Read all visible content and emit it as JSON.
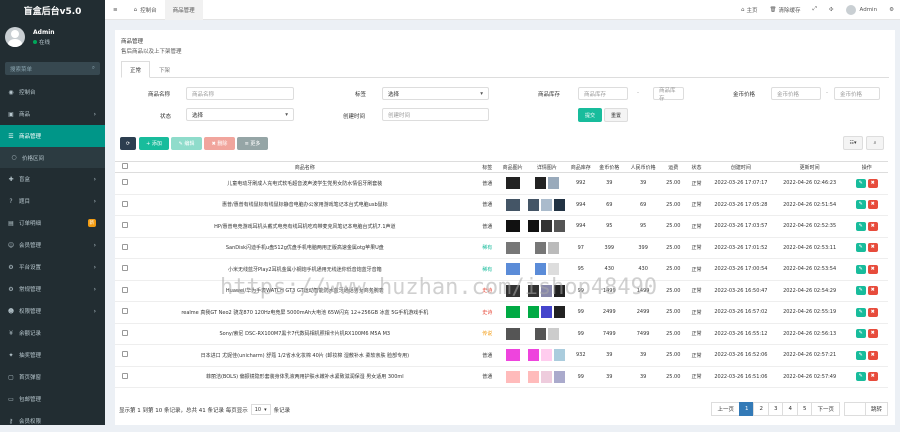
{
  "app": {
    "title": "盲盒后台v5.0"
  },
  "user": {
    "name": "Admin",
    "status": "在线"
  },
  "sidebar": {
    "search_placeholder": "搜索菜单",
    "items": [
      {
        "label": "控制台",
        "icon": "dashboard-icon"
      },
      {
        "label": "商品",
        "icon": "cube-icon",
        "arrow": "›"
      },
      {
        "label": "商品管理",
        "icon": "list-icon",
        "active": true
      },
      {
        "label": "价格区间",
        "icon": "circle-icon",
        "sub": true
      },
      {
        "label": "盲盒",
        "icon": "gift-icon",
        "arrow": "›"
      },
      {
        "label": "题目",
        "icon": "question-icon",
        "arrow": "›"
      },
      {
        "label": "订单明细",
        "icon": "order-icon",
        "badge": "新"
      },
      {
        "label": "会员管理",
        "icon": "users-icon",
        "arrow": "›"
      },
      {
        "label": "平台设置",
        "icon": "gear-icon",
        "arrow": "›"
      },
      {
        "label": "常规管理",
        "icon": "cogs-icon",
        "arrow": "›"
      },
      {
        "label": "权限管理",
        "icon": "group-icon",
        "arrow": "›"
      },
      {
        "label": "余额记录",
        "icon": "money-icon"
      },
      {
        "label": "抽奖管理",
        "icon": "lottery-icon"
      },
      {
        "label": "首页弹窗",
        "icon": "window-icon"
      },
      {
        "label": "包邮管理",
        "icon": "truck-icon"
      },
      {
        "label": "会员权限",
        "icon": "key-icon"
      }
    ]
  },
  "topbar": {
    "menu_icon": "≡",
    "tabs": [
      "控制台",
      "商品管理"
    ],
    "right": [
      "主页",
      "清除缓存",
      "Admin"
    ]
  },
  "panel": {
    "title": "商品管理",
    "desc": "售后商品以及上下架管理",
    "tabs": [
      "正常",
      "下架"
    ]
  },
  "filters": {
    "name_label": "商品名称",
    "name_placeholder": "商品名称",
    "tag_label": "标签",
    "tag_value": "选择",
    "stock_label": "商品库存",
    "stock_ph1": "商品库存",
    "stock_ph2": "商品库存",
    "coin_label": "金币价格",
    "coin_ph1": "金币价格",
    "coin_ph2": "金币价格",
    "status_label": "状态",
    "status_value": "选择",
    "time_label": "创建时间",
    "time_placeholder": "创建时间",
    "submit": "提交",
    "reset": "重置",
    "dash": "-"
  },
  "toolbar": {
    "refresh": "⟳",
    "add": "+ 添加",
    "edit": "✎ 编辑",
    "delete": "✖ 删除",
    "more": "≡ 更多"
  },
  "table": {
    "headers": [
      "商品名称",
      "标签",
      "商品图片",
      "详情图片",
      "商品库存",
      "金币价格",
      "人民币价格",
      "运费",
      "状态",
      "创建时间",
      "更新时间",
      "操作"
    ],
    "rows": [
      {
        "name": "儿童电动牙刷成人充电式软毛超音波声波学生党男女防水情侣牙刷套装",
        "tag": "普通",
        "tag_color": "#333",
        "stock": "992",
        "coin": "39",
        "rmb": "39",
        "fee": "25.00",
        "status": "正常",
        "created": "2022-03-26 17:07:17",
        "updated": "2022-04-26 02:46:23"
      },
      {
        "name": "惠普/惠普有线鼠标有线鼠标静音电脑办公家用游戏笔记本台式电脑usb鼠标",
        "tag": "普通",
        "tag_color": "#333",
        "stock": "994",
        "coin": "69",
        "rmb": "69",
        "fee": "25.00",
        "status": "正常",
        "created": "2022-03-26 17:05:28",
        "updated": "2022-04-26 02:51:54"
      },
      {
        "name": "HP/惠普电竞游戏耳机头戴式电竞有线耳机吃鸡带麦克风笔记本电脑台式机7.1声道",
        "tag": "普通",
        "tag_color": "#333",
        "stock": "994",
        "coin": "95",
        "rmb": "95",
        "fee": "25.00",
        "status": "正常",
        "created": "2022-03-26 17:03:57",
        "updated": "2022-04-26 02:52:35"
      },
      {
        "name": "SanDisk闪迪手机u盘512g优盘手机电脑两用正版高速金属otg苹果U盘",
        "tag": "稀有",
        "tag_color": "#18bc9c",
        "stock": "97",
        "coin": "399",
        "rmb": "399",
        "fee": "25.00",
        "status": "正常",
        "created": "2022-03-26 17:01:52",
        "updated": "2022-04-26 02:53:11"
      },
      {
        "name": "小米无线蓝牙Play2耳机金属小钢炮手机通用无线迷你低音炮蓝牙音箱",
        "tag": "稀有",
        "tag_color": "#18bc9c",
        "stock": "95",
        "coin": "430",
        "rmb": "430",
        "fee": "25.00",
        "status": "正常",
        "created": "2022-03-26 17:00:54",
        "updated": "2022-04-26 02:53:54"
      },
      {
        "name": "Huawei/华为手表WATCH GT3 GT运动智能防水蓝牙通话男女商务腕表",
        "tag": "史诗",
        "tag_color": "#e74c3c",
        "stock": "99",
        "coin": "1499",
        "rmb": "1499",
        "fee": "25.00",
        "status": "正常",
        "created": "2022-03-26 16:50:47",
        "updated": "2022-04-26 02:54:29"
      },
      {
        "name": "realme 真我GT Neo2 骁龙870 120Hz电竞屏 5000mAh大电池 65W闪充 12+256GB 冰蓝 5G手机游戏手机",
        "tag": "史诗",
        "tag_color": "#e74c3c",
        "stock": "99",
        "coin": "2499",
        "rmb": "2499",
        "fee": "25.00",
        "status": "正常",
        "created": "2022-03-26 16:57:02",
        "updated": "2022-04-26 02:55:19"
      },
      {
        "name": "Sony/索尼 DSC-RX100M7黑卡7代数码相机照相卡片机RX100M6 M5A M3",
        "tag": "传说",
        "tag_color": "#f39c12",
        "stock": "99",
        "coin": "7499",
        "rmb": "7499",
        "fee": "25.00",
        "status": "正常",
        "created": "2022-03-26 16:55:12",
        "updated": "2022-04-26 02:56:13"
      },
      {
        "name": "日本进口 尤妮佳(unicharm) 舒蔻 1/2省水化妆棉 40片 (卸妆棉 湿敷补水 柔软亲肤 脸部专用)",
        "tag": "普通",
        "tag_color": "#333",
        "stock": "932",
        "coin": "39",
        "rmb": "39",
        "fee": "25.00",
        "status": "正常",
        "created": "2022-03-26 16:52:06",
        "updated": "2022-04-26 02:57:21"
      },
      {
        "name": "菲丽洁(BOLS) 偏振镜隐形套装身体乳液两用护肤水嫩补水紧致滋润保湿 男女适用 300ml",
        "tag": "普通",
        "tag_color": "#333",
        "stock": "99",
        "coin": "39",
        "rmb": "39",
        "fee": "25.00",
        "status": "正常",
        "created": "2022-03-26 16:51:06",
        "updated": "2022-04-26 02:57:49"
      }
    ]
  },
  "footer": {
    "text1": "显示第 1 到第 10 条记录，总共 41 条记录 每页显示",
    "page_size": "10",
    "text2": "条记录"
  },
  "pager": {
    "prev": "上一页",
    "pages": [
      "1",
      "2",
      "3",
      "4",
      "5"
    ],
    "next": "下一页",
    "jump": "跳转"
  },
  "watermark": "https://www.huzhan.com/ishop48490",
  "colors": {
    "sidebar": "#222d32",
    "active": "#009688",
    "primary": "#18bc9c",
    "danger": "#e74c3c",
    "edit": "#18bc9c"
  }
}
